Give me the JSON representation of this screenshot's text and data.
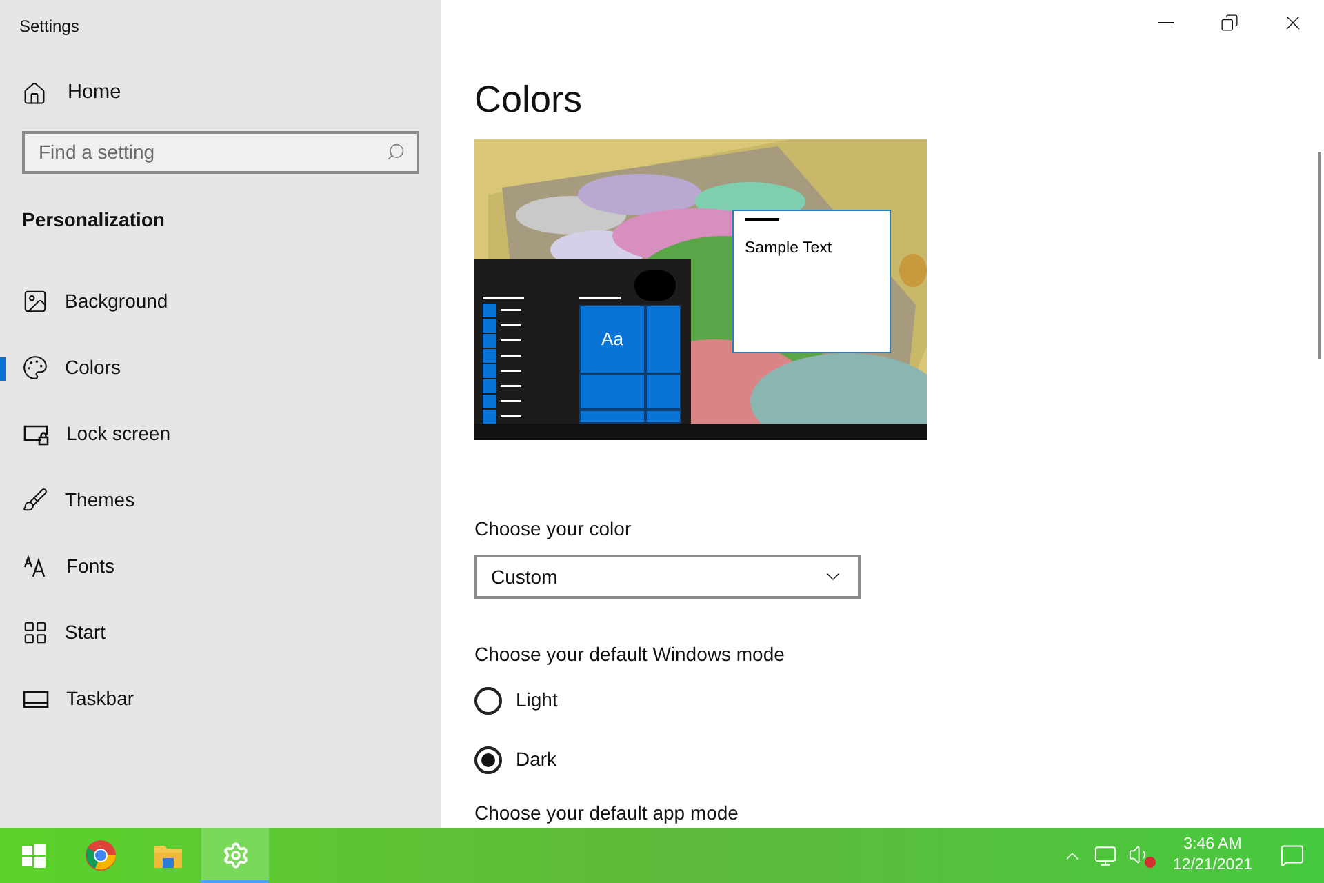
{
  "window": {
    "title": "Settings"
  },
  "sidebar": {
    "home": "Home",
    "search": {
      "placeholder": "Find a setting"
    },
    "section": "Personalization",
    "items": [
      {
        "label": "Background",
        "selected": false
      },
      {
        "label": "Colors",
        "selected": true
      },
      {
        "label": "Lock screen",
        "selected": false
      },
      {
        "label": "Themes",
        "selected": false
      },
      {
        "label": "Fonts",
        "selected": false
      },
      {
        "label": "Start",
        "selected": false
      },
      {
        "label": "Taskbar",
        "selected": false
      }
    ]
  },
  "main": {
    "title": "Colors",
    "preview": {
      "tile_text": "Aa",
      "sample_text": "Sample Text"
    },
    "color_label": "Choose your color",
    "color_value": "Custom",
    "mode_heading": "Choose your default Windows mode",
    "modes": [
      {
        "label": "Light",
        "selected": false
      },
      {
        "label": "Dark",
        "selected": true
      }
    ],
    "next_heading": "Choose your default app mode"
  },
  "taskbar": {
    "apps": [
      {
        "selected": false
      },
      {
        "selected": false
      },
      {
        "selected": true
      }
    ],
    "time": "3:46 AM",
    "date": "12/21/2021"
  }
}
